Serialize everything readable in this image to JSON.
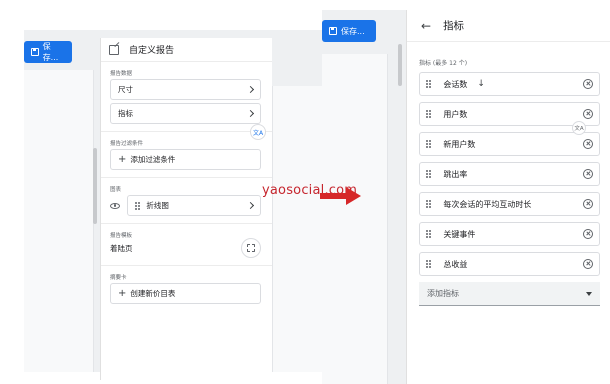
{
  "watermark": "yaosocial.com",
  "left": {
    "save_label": "保存...",
    "panel_title": "自定义报告",
    "sections": {
      "report_data": "报告数据",
      "filter": "报告过滤条件",
      "chart": "图表",
      "report_template": "报告模板",
      "summary_card": "摘要卡"
    },
    "rows": {
      "dimension": "尺寸",
      "metric": "指标",
      "add_filter": "添加过滤条件",
      "line_chart": "折线图",
      "landing_page": "着陆页",
      "create_card": "创建新价目表"
    },
    "translate_glyph": "文A"
  },
  "right": {
    "save_label": "保存...",
    "title": "指标",
    "subtitle": "指标 (最多 12 个)",
    "metrics": [
      {
        "name": "会话数",
        "sorted": true
      },
      {
        "name": "用户数",
        "sorted": false
      },
      {
        "name": "新用户数",
        "sorted": false
      },
      {
        "name": "跳出率",
        "sorted": false
      },
      {
        "name": "每次会话的平均互动时长",
        "sorted": false
      },
      {
        "name": "关键事件",
        "sorted": false
      },
      {
        "name": "总收益",
        "sorted": false
      }
    ],
    "add_metric": "添加指标",
    "translate_glyph": "文A"
  },
  "colors": {
    "accent": "#1a73e8",
    "arrow": "#d62728",
    "watermark": "#c6262e"
  }
}
